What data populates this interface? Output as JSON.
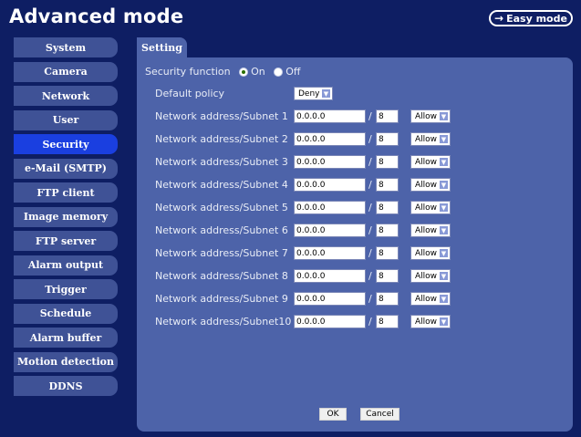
{
  "app": {
    "title": "Advanced mode",
    "easy_mode_label": "Easy mode"
  },
  "sidebar": {
    "items": [
      {
        "label": "System"
      },
      {
        "label": "Camera"
      },
      {
        "label": "Network"
      },
      {
        "label": "User"
      },
      {
        "label": "Security",
        "active": true
      },
      {
        "label": "e-Mail (SMTP)"
      },
      {
        "label": "FTP client"
      },
      {
        "label": "Image memory"
      },
      {
        "label": "FTP server"
      },
      {
        "label": "Alarm output"
      },
      {
        "label": "Trigger"
      },
      {
        "label": "Schedule"
      },
      {
        "label": "Alarm buffer"
      },
      {
        "label": "Motion detection"
      },
      {
        "label": "DDNS"
      }
    ]
  },
  "tab": {
    "label": "Setting"
  },
  "security": {
    "label": "Security function",
    "on_label": "On",
    "off_label": "Off",
    "selected": "On",
    "default_policy_label": "Default policy",
    "default_policy_value": "Deny",
    "slash": "/"
  },
  "subnets": [
    {
      "label": "Network address/Subnet 1",
      "address": "0.0.0.0",
      "prefix": "8",
      "action": "Allow"
    },
    {
      "label": "Network address/Subnet 2",
      "address": "0.0.0.0",
      "prefix": "8",
      "action": "Allow"
    },
    {
      "label": "Network address/Subnet 3",
      "address": "0.0.0.0",
      "prefix": "8",
      "action": "Allow"
    },
    {
      "label": "Network address/Subnet 4",
      "address": "0.0.0.0",
      "prefix": "8",
      "action": "Allow"
    },
    {
      "label": "Network address/Subnet 5",
      "address": "0.0.0.0",
      "prefix": "8",
      "action": "Allow"
    },
    {
      "label": "Network address/Subnet 6",
      "address": "0.0.0.0",
      "prefix": "8",
      "action": "Allow"
    },
    {
      "label": "Network address/Subnet 7",
      "address": "0.0.0.0",
      "prefix": "8",
      "action": "Allow"
    },
    {
      "label": "Network address/Subnet 8",
      "address": "0.0.0.0",
      "prefix": "8",
      "action": "Allow"
    },
    {
      "label": "Network address/Subnet 9",
      "address": "0.0.0.0",
      "prefix": "8",
      "action": "Allow"
    },
    {
      "label": "Network address/Subnet10",
      "address": "0.0.0.0",
      "prefix": "8",
      "action": "Allow"
    }
  ],
  "buttons": {
    "ok": "OK",
    "cancel": "Cancel"
  },
  "icons": {
    "easy_mode": "arrow-right-icon",
    "dropdown": "chevron-down-icon"
  },
  "colors": {
    "background": "#0e1e63",
    "panel": "#4d63a9",
    "nav": "#3f5296",
    "nav_active": "#1a3fe0"
  }
}
